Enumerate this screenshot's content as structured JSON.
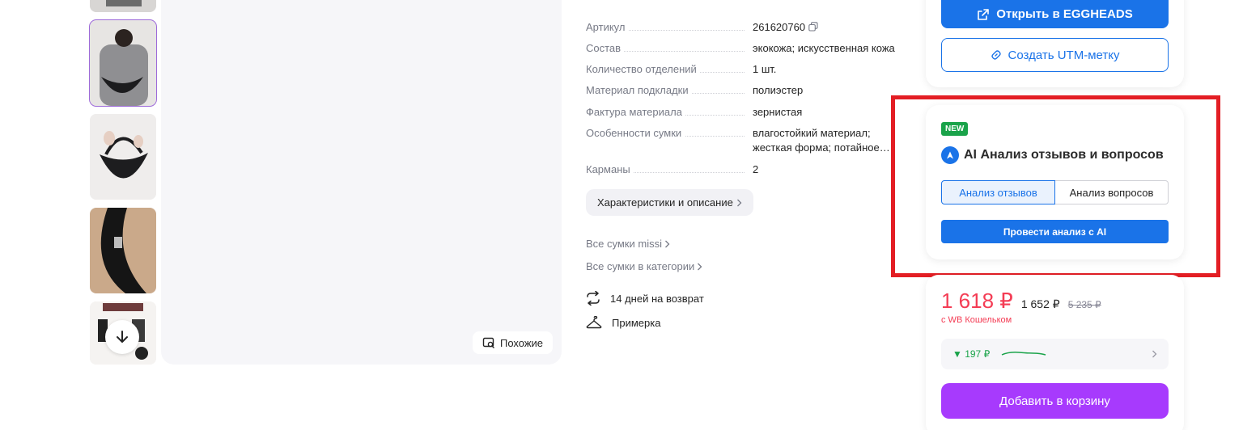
{
  "product": {
    "similar_label": "Похожие",
    "specs": [
      {
        "label": "Артикул",
        "value": "261620760"
      },
      {
        "label": "Состав",
        "value": "экокожа; искусственная кожа"
      },
      {
        "label": "Количество отделений",
        "value": "1 шт."
      },
      {
        "label": "Материал подкладки",
        "value": "полиэстер"
      },
      {
        "label": "Фактура материала",
        "value": "зернистая"
      },
      {
        "label": "Особенности сумки",
        "value": "влагостойкий материал; жесткая форма; потайное…"
      },
      {
        "label": "Карманы",
        "value": "2"
      }
    ],
    "details_chip": "Характеристики и описание",
    "links": [
      "Все сумки missi",
      "Все сумки в категории"
    ],
    "features": [
      {
        "icon": "return-arrows-icon",
        "label": "14 дней на возврат"
      },
      {
        "icon": "hanger-icon",
        "label": "Примерка"
      }
    ]
  },
  "egg": {
    "open_label": "Открыть в EGGHEADS",
    "utm_label": "Создать UTM-метку"
  },
  "ai": {
    "badge": "NEW",
    "title": "AI Анализ отзывов и вопросов",
    "tabs": [
      "Анализ отзывов",
      "Анализ вопросов"
    ],
    "run_label": "Провести анализ с AI"
  },
  "price": {
    "current": "1 618 ₽",
    "alt": "1 652 ₽",
    "old": "5 235 ₽",
    "wallet_note": "с WB Кошельком",
    "history_delta": "▼ 197 ₽",
    "cart_label": "Добавить в корзину"
  },
  "colors": {
    "accent_blue": "#1a73e8",
    "price_red": "#f43c54",
    "cart_purple": "#a73afd",
    "highlight_red": "#e31e24",
    "badge_green": "#1aa34a"
  }
}
